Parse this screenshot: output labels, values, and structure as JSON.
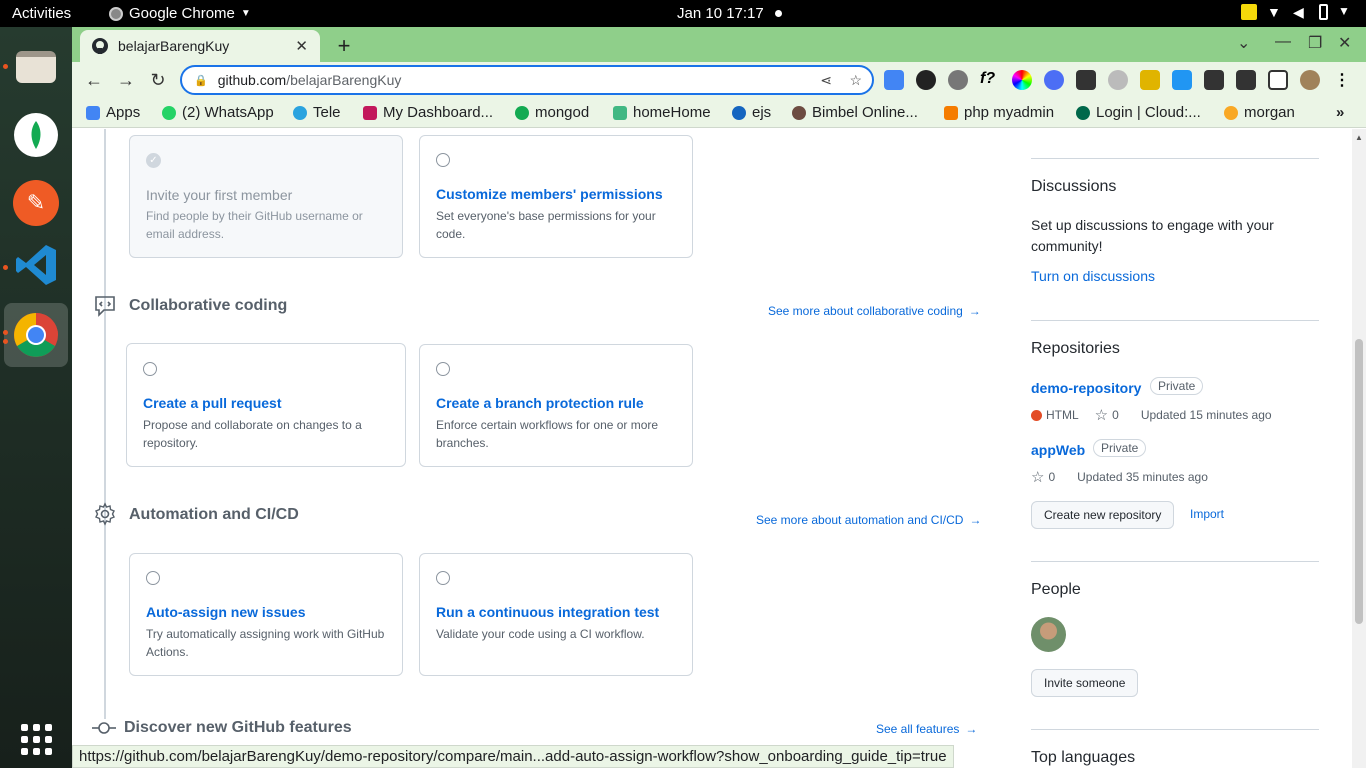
{
  "system": {
    "activities": "Activities",
    "app_name": "Google Chrome",
    "clock": "Jan 10  17:17"
  },
  "browser": {
    "tab_title": "belajarBarengKuy",
    "url_host": "github.com",
    "url_path": "/belajarBarengKuy",
    "status_url": "https://github.com/belajarBarengKuy/demo-repository/compare/main...add-auto-assign-workflow?show_onboarding_guide_tip=true"
  },
  "bookmarks": [
    {
      "label": "Apps",
      "color": "#4285f4"
    },
    {
      "label": "(2) WhatsApp",
      "color": "#25d366"
    },
    {
      "label": "Tele",
      "color": "#2aa3df"
    },
    {
      "label": "My Dashboard...",
      "color": "#c2185b"
    },
    {
      "label": "mongod",
      "color": "#13aa52"
    },
    {
      "label": "homeHome",
      "color": "#41b883"
    },
    {
      "label": "ejs",
      "color": "#1565c0"
    },
    {
      "label": "Bimbel Online...",
      "color": "#6d4c41"
    },
    {
      "label": "php myadmin",
      "color": "#f57c00"
    },
    {
      "label": "Login | Cloud:...",
      "color": "#00684a"
    },
    {
      "label": "morgan",
      "color": "#f9a825"
    }
  ],
  "onboarding": {
    "first_cards": [
      {
        "title": "Invite your first member",
        "desc": "Find people by their GitHub username or email address.",
        "done": true
      },
      {
        "title": "Customize members' permissions",
        "desc": "Set everyone's base permissions for your code.",
        "done": false
      }
    ],
    "collab": {
      "title": "Collaborative coding",
      "see_more": "See more about collaborative coding",
      "cards": [
        {
          "title": "Create a pull request",
          "desc": "Propose and collaborate on changes to a repository."
        },
        {
          "title": "Create a branch protection rule",
          "desc": "Enforce certain workflows for one or more branches."
        }
      ]
    },
    "automation": {
      "title": "Automation and CI/CD",
      "see_more": "See more about automation and CI/CD",
      "cards": [
        {
          "title": "Auto-assign new issues",
          "desc": "Try automatically assigning work with GitHub Actions."
        },
        {
          "title": "Run a continuous integration test",
          "desc": "Validate your code using a CI workflow."
        }
      ]
    },
    "discover": {
      "title": "Discover new GitHub features",
      "see_all": "See all features"
    }
  },
  "sidebar": {
    "discussions": {
      "heading": "Discussions",
      "text": "Set up discussions to engage with your community!",
      "link": "Turn on discussions"
    },
    "repositories": {
      "heading": "Repositories",
      "items": [
        {
          "name": "demo-repository",
          "visibility": "Private",
          "language": "HTML",
          "lang_color": "#e34c26",
          "stars": "0",
          "updated": "Updated 15 minutes ago"
        },
        {
          "name": "appWeb",
          "visibility": "Private",
          "language": "",
          "lang_color": "",
          "stars": "0",
          "updated": "Updated 35 minutes ago"
        }
      ],
      "create_button": "Create new repository",
      "import_link": "Import"
    },
    "people": {
      "heading": "People",
      "invite_button": "Invite someone"
    },
    "top_languages": {
      "heading": "Top languages"
    }
  }
}
